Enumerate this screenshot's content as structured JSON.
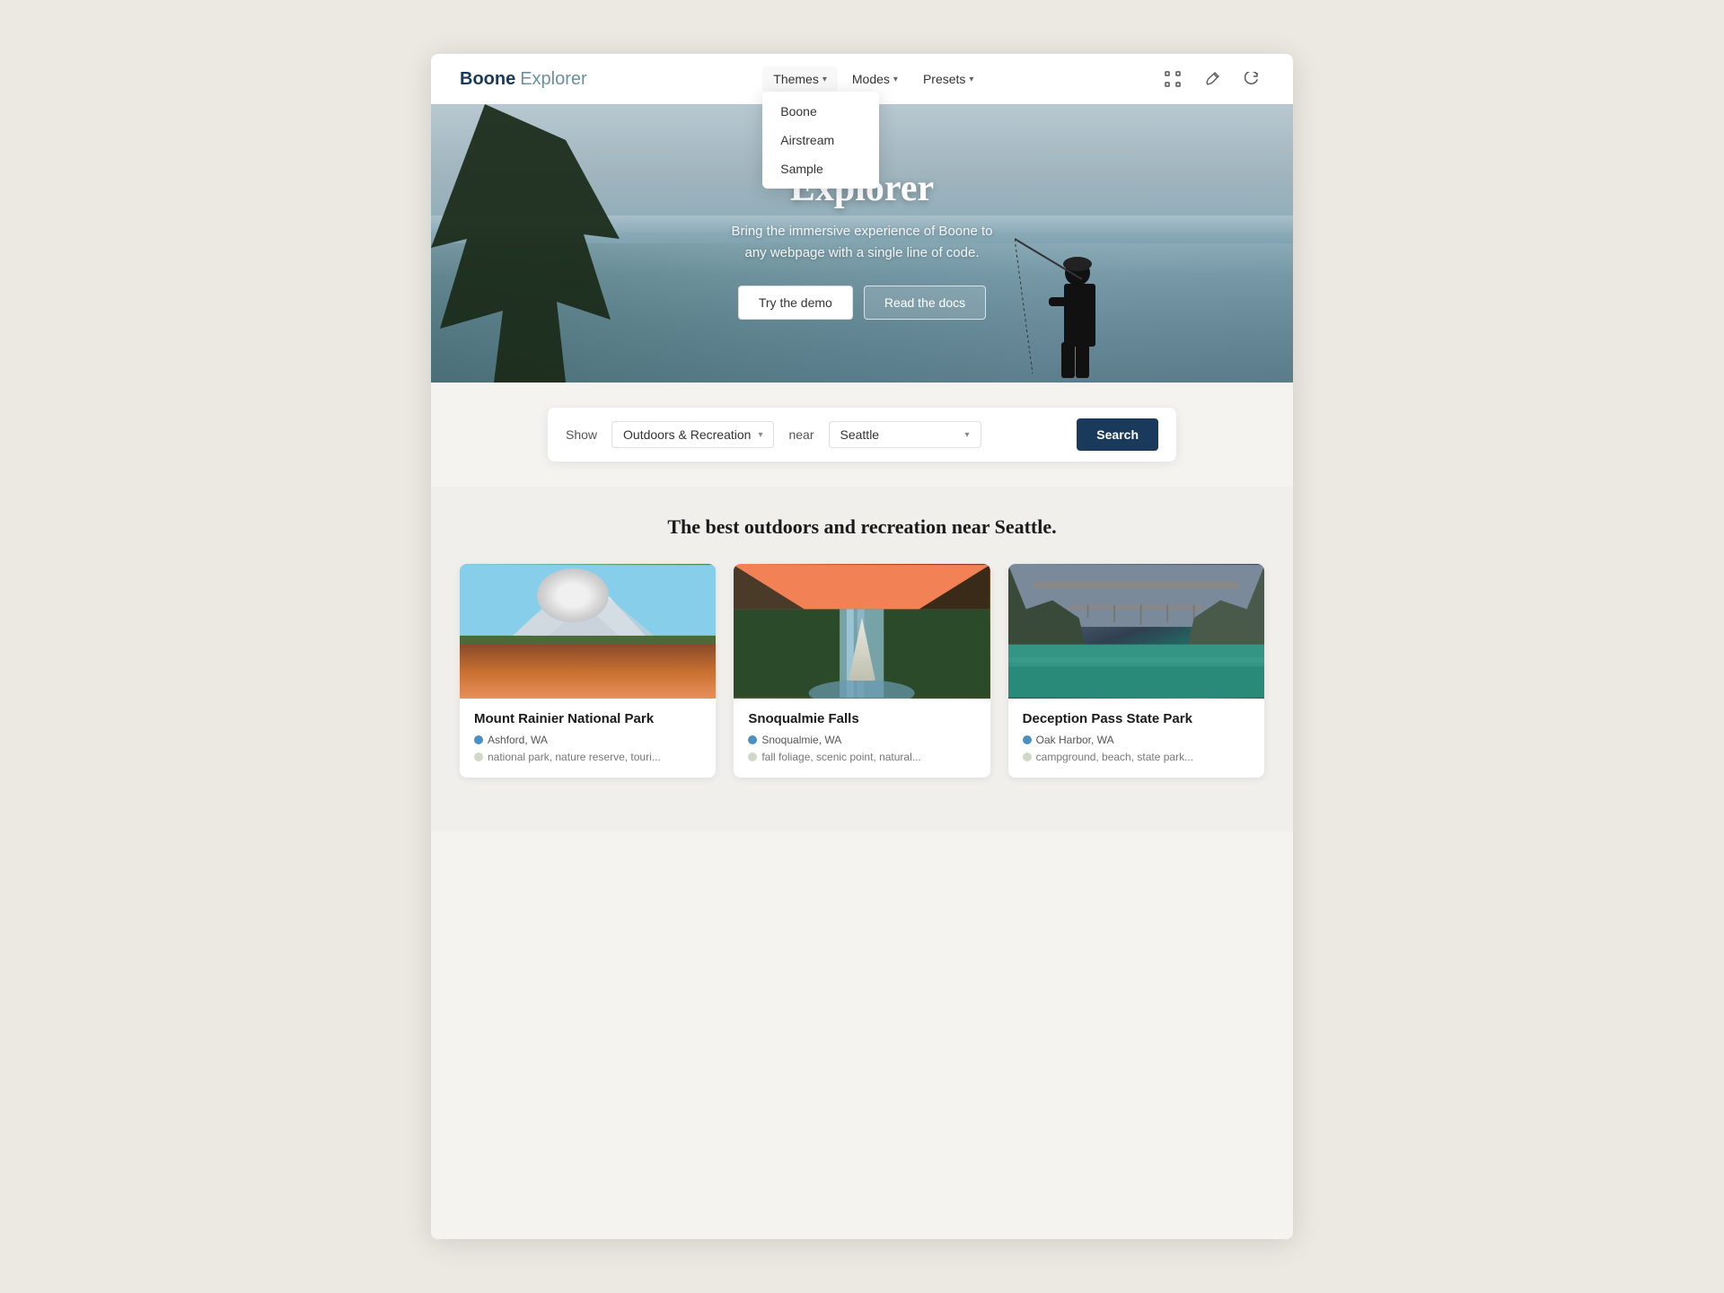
{
  "logo": {
    "boone": "Boone",
    "explorer": "Explorer"
  },
  "nav": {
    "themes_label": "Themes",
    "modes_label": "Modes",
    "presets_label": "Presets",
    "themes_items": [
      "Boone",
      "Airstream",
      "Sample"
    ]
  },
  "header_icons": {
    "scan": "⊞",
    "edit": "✏",
    "refresh": "↺"
  },
  "hero": {
    "title": "Explorer",
    "subtitle_line1": "Bring the immersive experience of Boone to",
    "subtitle_line2": "any webpage with a single line of code.",
    "btn_try": "Try the demo",
    "btn_docs": "Read the docs"
  },
  "search": {
    "show_label": "Show",
    "category": "Outdoors & Recreation",
    "near_label": "near",
    "location": "Seattle",
    "btn_label": "Search"
  },
  "results": {
    "heading": "The best outdoors and recreation near Seattle.",
    "cards": [
      {
        "title": "Mount Rainier National Park",
        "location": "Ashford, WA",
        "tags": "national park, nature reserve, touri..."
      },
      {
        "title": "Snoqualmie Falls",
        "location": "Snoqualmie, WA",
        "tags": "fall foliage, scenic point, natural..."
      },
      {
        "title": "Deception Pass State Park",
        "location": "Oak Harbor, WA",
        "tags": "campground, beach, state park..."
      }
    ]
  }
}
